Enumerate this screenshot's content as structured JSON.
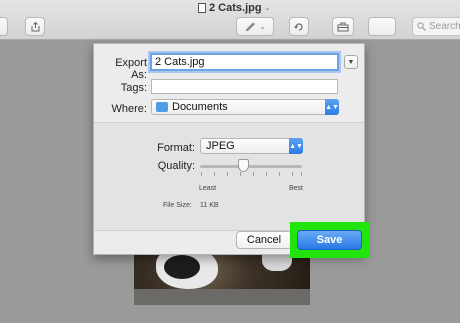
{
  "window": {
    "title": "2 Cats.jpg",
    "title_chevron": "⌄",
    "search_placeholder": "Search"
  },
  "toolbar": {
    "share_icon": "share-icon",
    "markup_icon": "pen-icon",
    "rotate_icon": "rotate-icon",
    "toolbox_icon": "toolbox-icon",
    "search_icon": "magnifier-icon"
  },
  "export": {
    "export_as_label": "Export As:",
    "export_as_value": "2 Cats.jpg",
    "tags_label": "Tags:",
    "tags_value": "",
    "where_label": "Where:",
    "where_value": "Documents",
    "format_label": "Format:",
    "format_value": "JPEG",
    "quality_label": "Quality:",
    "quality_level": 0.42,
    "least_label": "Least",
    "best_label": "Best",
    "file_size_label": "File Size:",
    "file_size_value": "11 KB",
    "cancel_label": "Cancel",
    "save_label": "Save"
  },
  "colors": {
    "accent": "#2f7de1",
    "highlight": "#22e40c",
    "focus": "#6da3e4"
  }
}
